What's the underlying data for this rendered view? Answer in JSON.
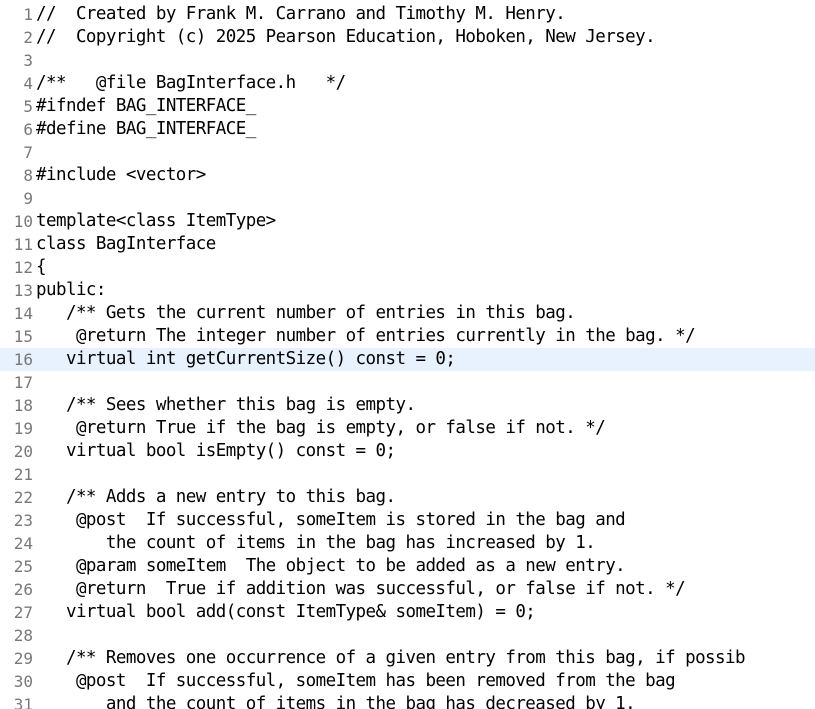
{
  "editor": {
    "current_line": 16,
    "lines": [
      {
        "num": "1",
        "text": "//  Created by Frank M. Carrano and Timothy M. Henry."
      },
      {
        "num": "2",
        "text": "//  Copyright (c) 2025 Pearson Education, Hoboken, New Jersey."
      },
      {
        "num": "3",
        "text": ""
      },
      {
        "num": "4",
        "text": "/**   @file BagInterface.h   */"
      },
      {
        "num": "5",
        "text": "#ifndef BAG_INTERFACE_"
      },
      {
        "num": "6",
        "text": "#define BAG_INTERFACE_"
      },
      {
        "num": "7",
        "text": ""
      },
      {
        "num": "8",
        "text": "#include <vector>"
      },
      {
        "num": "9",
        "text": ""
      },
      {
        "num": "10",
        "text": "template<class ItemType>"
      },
      {
        "num": "11",
        "text": "class BagInterface"
      },
      {
        "num": "12",
        "text": "{"
      },
      {
        "num": "13",
        "text": "public:"
      },
      {
        "num": "14",
        "text": "   /** Gets the current number of entries in this bag."
      },
      {
        "num": "15",
        "text": "    @return The integer number of entries currently in the bag. */"
      },
      {
        "num": "16",
        "text": "   virtual int getCurrentSize() const = 0;"
      },
      {
        "num": "17",
        "text": ""
      },
      {
        "num": "18",
        "text": "   /** Sees whether this bag is empty."
      },
      {
        "num": "19",
        "text": "    @return True if the bag is empty, or false if not. */"
      },
      {
        "num": "20",
        "text": "   virtual bool isEmpty() const = 0;"
      },
      {
        "num": "21",
        "text": ""
      },
      {
        "num": "22",
        "text": "   /** Adds a new entry to this bag."
      },
      {
        "num": "23",
        "text": "    @post  If successful, someItem is stored in the bag and"
      },
      {
        "num": "24",
        "text": "       the count of items in the bag has increased by 1."
      },
      {
        "num": "25",
        "text": "    @param someItem  The object to be added as a new entry."
      },
      {
        "num": "26",
        "text": "    @return  True if addition was successful, or false if not. */"
      },
      {
        "num": "27",
        "text": "   virtual bool add(const ItemType& someItem) = 0;"
      },
      {
        "num": "28",
        "text": ""
      },
      {
        "num": "29",
        "text": "   /** Removes one occurrence of a given entry from this bag, if possib"
      },
      {
        "num": "30",
        "text": "    @post  If successful, someItem has been removed from the bag"
      },
      {
        "num": "31",
        "text": "       and the count of items in the bag has decreased by 1."
      }
    ]
  }
}
